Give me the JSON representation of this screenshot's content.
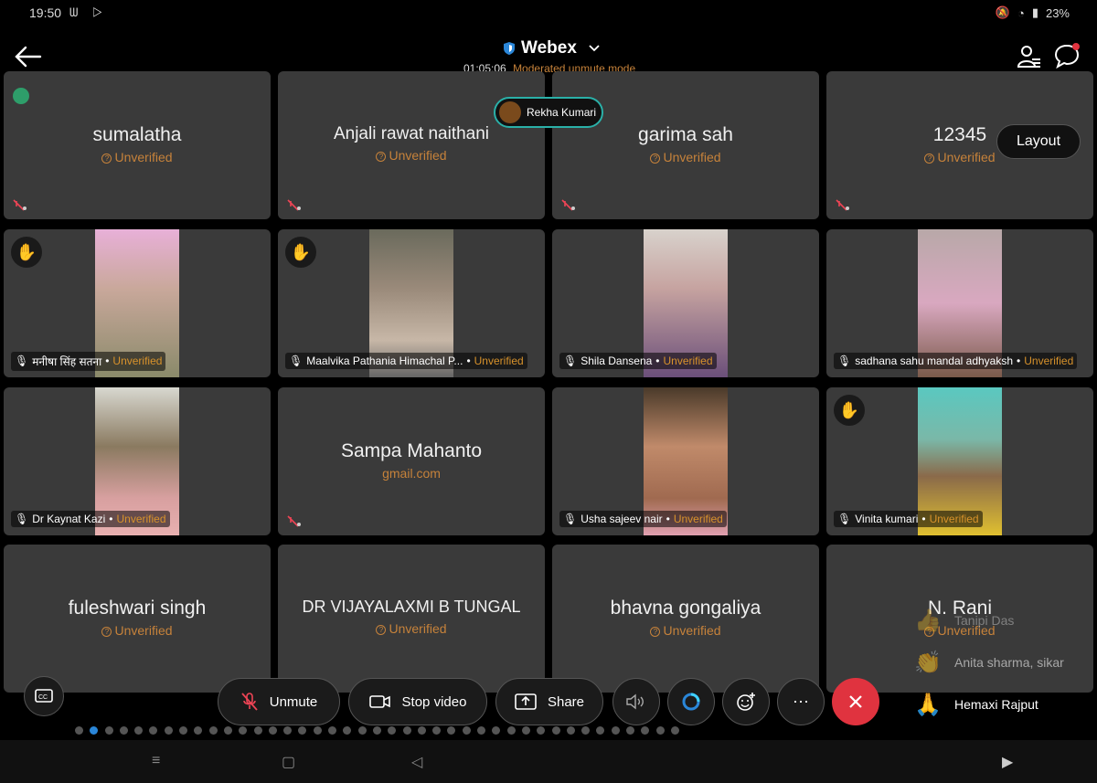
{
  "status": {
    "time": "19:50",
    "battery": "23%"
  },
  "header": {
    "app_title": "Webex",
    "timer": "01:05:06",
    "mode": "Moderated unmute mode"
  },
  "active_speaker": "Rekha Kumari",
  "layout_label": "Layout",
  "tiles": [
    {
      "name": "sumalatha",
      "sub": "Unverified"
    },
    {
      "name": "Anjali rawat naithani",
      "sub": "Unverified"
    },
    {
      "name": "garima sah",
      "sub": "Unverified"
    },
    {
      "name": "12345",
      "sub": "Unverified"
    },
    {
      "name": "मनीषा सिंह सतना",
      "sub": "Unverified"
    },
    {
      "name": "Maalvika Pathania Himachal P...",
      "sub": "Unverified"
    },
    {
      "name": "Shila Dansena",
      "sub": "Unverified"
    },
    {
      "name": "sadhana sahu mandal adhyaksh",
      "sub": "Unverified"
    },
    {
      "name": "Dr Kaynat Kazi",
      "sub": "Unverified"
    },
    {
      "name": "Sampa Mahanto",
      "sub": "gmail.com"
    },
    {
      "name": "Usha sajeev nair",
      "sub": "Unverified"
    },
    {
      "name": "Vinita kumari",
      "sub": "Unverified"
    },
    {
      "name": "fuleshwari singh",
      "sub": "Unverified"
    },
    {
      "name": "DR VIJAYALAXMI B TUNGAL",
      "sub": "Unverified"
    },
    {
      "name": "bhavna gongaliya",
      "sub": "Unverified"
    },
    {
      "name": "N. Rani",
      "sub": "Unverified"
    }
  ],
  "reactions": [
    {
      "name": "Tanipi Das"
    },
    {
      "name": "Anita sharma, sikar"
    },
    {
      "name": "Hemaxi Rajput"
    }
  ],
  "controls": {
    "unmute": "Unmute",
    "stop_video": "Stop video",
    "share": "Share"
  },
  "pagination": {
    "total": 41,
    "current": 2
  }
}
